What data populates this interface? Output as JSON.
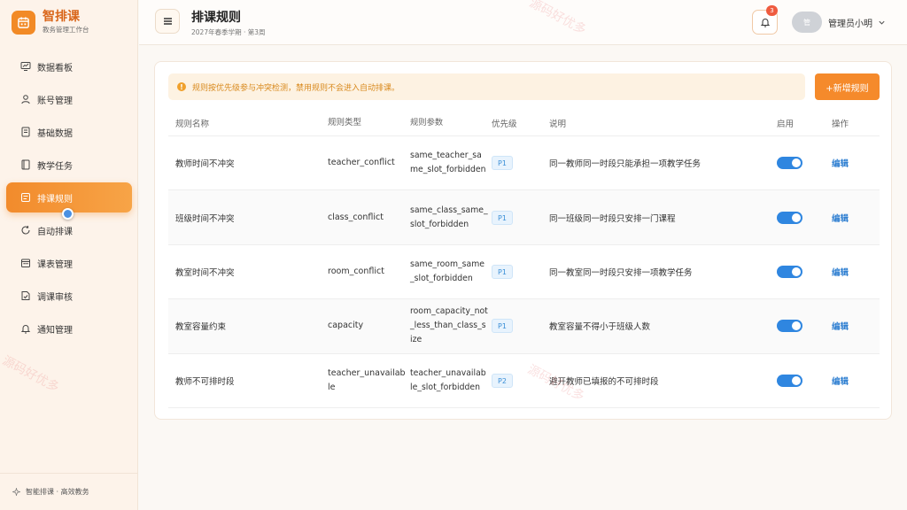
{
  "brand": {
    "title": "智排课",
    "subtitle": "教务管理工作台"
  },
  "sidebar": {
    "items": [
      {
        "label": "数据看板",
        "icon": "monitor-icon",
        "active": false
      },
      {
        "label": "账号管理",
        "icon": "user-icon",
        "active": false
      },
      {
        "label": "基础数据",
        "icon": "database-icon",
        "active": false
      },
      {
        "label": "教学任务",
        "icon": "book-icon",
        "active": false
      },
      {
        "label": "排课规则",
        "icon": "rules-icon",
        "active": true
      },
      {
        "label": "自动排课",
        "icon": "refresh-icon",
        "active": false
      },
      {
        "label": "课表管理",
        "icon": "calendar-icon",
        "active": false
      },
      {
        "label": "调课审核",
        "icon": "review-icon",
        "active": false
      },
      {
        "label": "通知管理",
        "icon": "bell-icon",
        "active": false
      }
    ],
    "footer": "智能排课 · 高效教务"
  },
  "header": {
    "title": "排课规则",
    "subtitle": "2027年春季学期 · 第3周",
    "notification_count": "3",
    "user_name": "管理员小明",
    "avatar_text": "管"
  },
  "notice": "规则按优先级参与冲突检测，禁用规则不会进入自动排课。",
  "add_button": "+新增规则",
  "table": {
    "headers": [
      "规则名称",
      "规则类型",
      "规则参数",
      "优先级",
      "说明",
      "启用",
      "操作"
    ],
    "rows": [
      {
        "name": "教师时间不冲突",
        "type": "teacher_conflict",
        "param": "same_teacher_same_slot_forbidden",
        "priority": "P1",
        "desc": "同一教师同一时段只能承担一项教学任务",
        "enabled": true,
        "action": "编辑"
      },
      {
        "name": "班级时间不冲突",
        "type": "class_conflict",
        "param": "same_class_same_slot_forbidden",
        "priority": "P1",
        "desc": "同一班级同一时段只安排一门课程",
        "enabled": true,
        "action": "编辑"
      },
      {
        "name": "教室时间不冲突",
        "type": "room_conflict",
        "param": "same_room_same_slot_forbidden",
        "priority": "P1",
        "desc": "同一教室同一时段只安排一项教学任务",
        "enabled": true,
        "action": "编辑"
      },
      {
        "name": "教室容量约束",
        "type": "capacity",
        "param": "room_capacity_not_less_than_class_size",
        "priority": "P1",
        "desc": "教室容量不得小于班级人数",
        "enabled": true,
        "action": "编辑"
      },
      {
        "name": "教师不可排时段",
        "type": "teacher_unavailable",
        "param": "teacher_unavailable_slot_forbidden",
        "priority": "P2",
        "desc": "避开教师已填报的不可排时段",
        "enabled": true,
        "action": "编辑"
      }
    ]
  },
  "watermark": "源码好优多",
  "colors": {
    "accent": "#f58a2b",
    "toggle_on": "#2f86e0",
    "link": "#2f7fd1"
  }
}
